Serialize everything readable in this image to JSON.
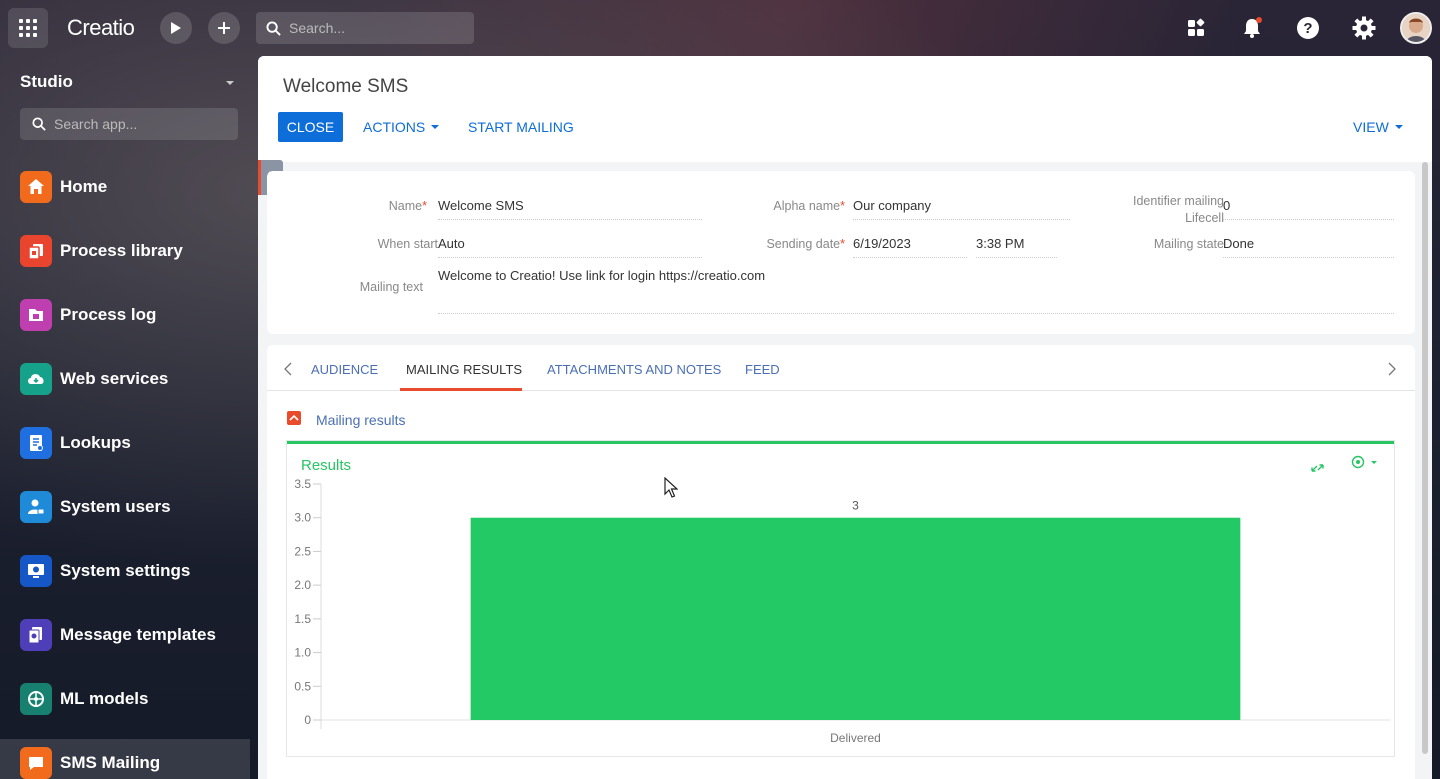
{
  "topbar": {
    "logo": "Creatio",
    "search_placeholder": "Search..."
  },
  "sidebar": {
    "workspace": "Studio",
    "search_placeholder": "Search app...",
    "items": [
      {
        "label": "Home",
        "color": "#f26a1b",
        "icon": "home-icon"
      },
      {
        "label": "Process library",
        "color": "#e9452e",
        "icon": "process-library-icon"
      },
      {
        "label": "Process log",
        "color": "#c03fb0",
        "icon": "process-log-icon"
      },
      {
        "label": "Web services",
        "color": "#15a18a",
        "icon": "web-services-icon"
      },
      {
        "label": "Lookups",
        "color": "#1f6fe0",
        "icon": "lookups-icon"
      },
      {
        "label": "System users",
        "color": "#1e8ad8",
        "icon": "system-users-icon"
      },
      {
        "label": "System settings",
        "color": "#1657c8",
        "icon": "system-settings-icon"
      },
      {
        "label": "Message templates",
        "color": "#4e3fb8",
        "icon": "message-templates-icon"
      },
      {
        "label": "ML models",
        "color": "#17806e",
        "icon": "ml-models-icon"
      },
      {
        "label": "SMS Mailing",
        "color": "#f26a1b",
        "icon": "sms-mailing-icon"
      }
    ]
  },
  "header": {
    "title": "Welcome SMS",
    "close_label": "CLOSE",
    "actions_label": "ACTIONS",
    "start_mailing_label": "START MAILING",
    "view_label": "VIEW"
  },
  "form": {
    "name_label": "Name",
    "name_value": "Welcome SMS",
    "alpha_label": "Alpha name",
    "alpha_value": "Our company",
    "identifier_label_1": "Identifier mailing",
    "identifier_label_2": "Lifecell",
    "identifier_value": "0",
    "when_label": "When start",
    "when_value": "Auto",
    "sending_label": "Sending date",
    "sending_date": "6/19/2023",
    "sending_time": "3:38 PM",
    "state_label": "Mailing state",
    "state_value": "Done",
    "text_label": "Mailing text",
    "text_value": "Welcome to Creatio! Use link for login https://creatio.com"
  },
  "tabs": {
    "items": [
      "AUDIENCE",
      "MAILING RESULTS",
      "ATTACHMENTS AND NOTES",
      "FEED"
    ],
    "active": "MAILING RESULTS"
  },
  "group": {
    "title": "Mailing results"
  },
  "chart_data": {
    "type": "bar",
    "title": "Results",
    "categories": [
      "Delivered"
    ],
    "values": [
      3
    ],
    "data_labels": [
      "3"
    ],
    "ylim": [
      0,
      3.5
    ],
    "yticks": [
      "3.5",
      "3.0",
      "2.5",
      "2.0",
      "1.5",
      "1.0",
      "0.5",
      "0"
    ],
    "bar_color": "#22c965",
    "grid": false
  }
}
